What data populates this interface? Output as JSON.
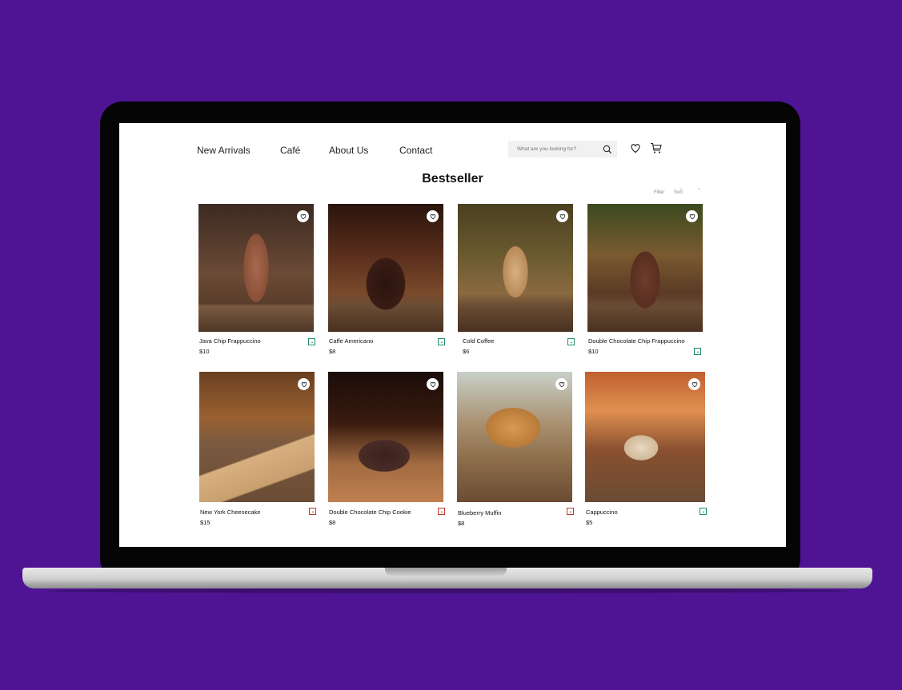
{
  "nav": {
    "links": [
      "New Arrivals",
      "Café",
      "About Us",
      "Contact"
    ],
    "search_placeholder": "What are you looking for?",
    "icons": [
      "search-icon",
      "heart-icon",
      "cart-icon"
    ]
  },
  "section": {
    "title": "Bestseller",
    "filter_label": "Filter",
    "sort_label": "Sort"
  },
  "colors": {
    "background": "#4f1494",
    "veg_marker": "#1f8f6f",
    "nonveg_marker": "#c0392b"
  },
  "products": [
    {
      "name": "Java Chip Frappuccino",
      "price": "$10",
      "marker": "green"
    },
    {
      "name": "Caffe Americano",
      "price": "$8",
      "marker": "green"
    },
    {
      "name": "Cold Coffee",
      "price": "$6",
      "marker": "green"
    },
    {
      "name": "Double Chocolate Chip Frappuccino",
      "price": "$10",
      "marker": "green"
    },
    {
      "name": "New York Cheesecake",
      "price": "$15",
      "marker": "red"
    },
    {
      "name": "Double Chocolate Chip Cookie",
      "price": "$8",
      "marker": "red"
    },
    {
      "name": "Blueberry Muffin",
      "price": "$8",
      "marker": "red"
    },
    {
      "name": "Cappuccino",
      "price": "$5",
      "marker": "green"
    }
  ]
}
